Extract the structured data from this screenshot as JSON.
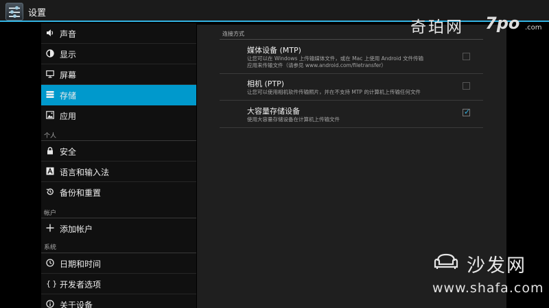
{
  "actionbar": {
    "title": "设置",
    "icon": "settings-app-icon"
  },
  "sidebar": {
    "items": [
      {
        "label": "声音",
        "icon": "speaker-icon"
      },
      {
        "label": "显示",
        "icon": "brightness-icon"
      },
      {
        "label": "屏幕",
        "icon": "monitor-icon"
      },
      {
        "label": "存储",
        "icon": "storage-icon",
        "selected": true
      },
      {
        "label": "应用",
        "icon": "apps-icon"
      }
    ],
    "personal_header": "个人",
    "personal_items": [
      {
        "label": "安全",
        "icon": "lock-icon"
      },
      {
        "label": "语言和输入法",
        "icon": "language-icon"
      },
      {
        "label": "备份和重置",
        "icon": "backup-icon"
      }
    ],
    "accounts_header": "帐户",
    "accounts_items": [
      {
        "label": "添加帐户",
        "icon": "plus-icon"
      }
    ],
    "system_header": "系统",
    "system_items": [
      {
        "label": "日期和时间",
        "icon": "clock-icon"
      },
      {
        "label": "开发者选项",
        "icon": "braces-icon"
      },
      {
        "label": "关于设备",
        "icon": "info-icon"
      }
    ]
  },
  "main": {
    "section_title": "连接方式",
    "options": [
      {
        "title": "媒体设备 (MTP)",
        "summary_line1": "让您可以在 Windows 上传输媒体文件，或在 Mac 上使用 Android 文件传输",
        "summary_line2": "应用来传输文件（请参见 www.android.com/filetransfer）",
        "checked": false
      },
      {
        "title": "相机 (PTP)",
        "summary_line1": "让您可以使用相机软件传输照片，并在不支持 MTP 的计算机上传输任何文件",
        "summary_line2": "",
        "checked": false
      },
      {
        "title": "大容量存储设备",
        "summary_line1": "使用大容量存储设备在计算机上传输文件",
        "summary_line2": "",
        "checked": true
      }
    ]
  },
  "watermarks": {
    "top_text": "奇珀网",
    "top_logo": "7po",
    "top_com": ".com",
    "bottom_text": "沙发网",
    "bottom_url": "www.shafa.com"
  },
  "colors": {
    "accent": "#33b5e5",
    "selected_bg": "#0099cc"
  }
}
